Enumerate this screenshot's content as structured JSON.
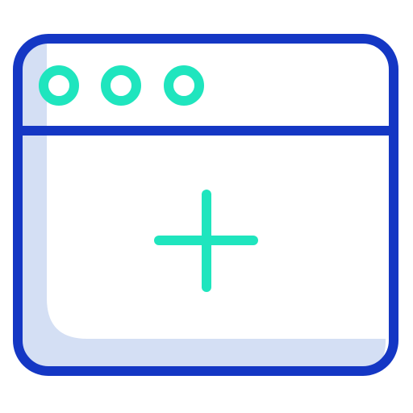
{
  "icon": {
    "name": "add-new-window-icon",
    "colors": {
      "outline": "#1437C4",
      "accent": "#1FE5BE",
      "shadow": "#D4DFF4",
      "background": "#FFFFFF"
    },
    "parts": {
      "window_controls": [
        "dot-icon",
        "dot-icon",
        "dot-icon"
      ],
      "center_symbol": "plus-icon"
    }
  }
}
